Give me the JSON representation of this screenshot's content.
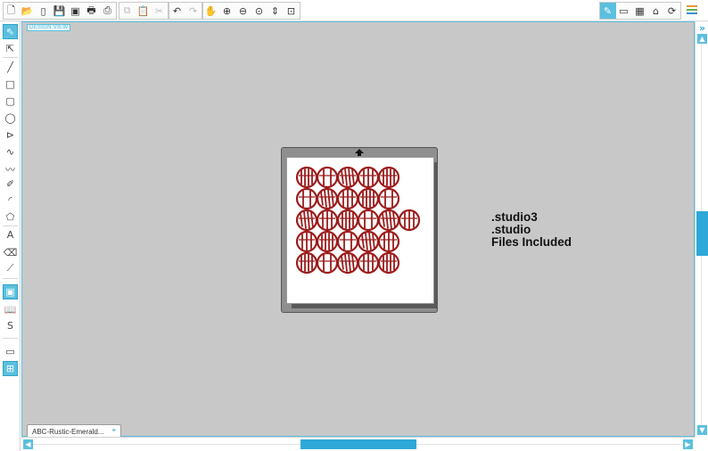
{
  "toolbar": {
    "left_tools": [
      {
        "name": "new-document-icon",
        "glyph": "🗋",
        "enabled": true
      },
      {
        "name": "open-folder-icon",
        "glyph": "📂",
        "enabled": true
      },
      {
        "name": "open-library-icon",
        "glyph": "▯",
        "enabled": true
      },
      {
        "name": "save-icon",
        "glyph": "💾",
        "enabled": true
      },
      {
        "name": "save-to-library-icon",
        "glyph": "▣",
        "enabled": true
      },
      {
        "name": "print-icon",
        "glyph": "🖶",
        "enabled": true
      },
      {
        "name": "send-to-cutter-icon",
        "glyph": "⎙",
        "enabled": true
      },
      {
        "name": "copy-icon",
        "glyph": "⧉",
        "enabled": false
      },
      {
        "name": "paste-icon",
        "glyph": "📋",
        "enabled": false
      },
      {
        "name": "cut-scissors-icon",
        "glyph": "✂",
        "enabled": false
      },
      {
        "name": "undo-icon",
        "glyph": "↶",
        "enabled": true
      },
      {
        "name": "redo-icon",
        "glyph": "↷",
        "enabled": false
      },
      {
        "name": "pan-hand-icon",
        "glyph": "✋",
        "enabled": true
      },
      {
        "name": "zoom-in-icon",
        "glyph": "⊕",
        "enabled": true
      },
      {
        "name": "zoom-out-icon",
        "glyph": "⊖",
        "enabled": true
      },
      {
        "name": "zoom-select-icon",
        "glyph": "⊙",
        "enabled": true
      },
      {
        "name": "zoom-drag-icon",
        "glyph": "⇕",
        "enabled": true
      },
      {
        "name": "fit-to-window-icon",
        "glyph": "⊡",
        "enabled": true
      }
    ],
    "right_tools": [
      {
        "name": "design-view-icon",
        "glyph": "✎",
        "active": true
      },
      {
        "name": "page-setup-icon",
        "glyph": "▭",
        "active": false
      },
      {
        "name": "cut-settings-icon",
        "glyph": "▦",
        "active": false
      },
      {
        "name": "library-home-icon",
        "glyph": "⌂",
        "active": false
      },
      {
        "name": "online-store-icon",
        "glyph": "⟳",
        "active": false
      }
    ],
    "menu_icon": "menu-lines-icon"
  },
  "left_panel": {
    "tools": [
      {
        "name": "select-arrow-icon",
        "glyph": "⇖",
        "active": true
      },
      {
        "name": "edit-points-icon",
        "glyph": "⇱",
        "active": false
      },
      {
        "name": "line-tool-icon",
        "glyph": "╱",
        "active": false
      },
      {
        "name": "rectangle-tool-icon",
        "glyph": "□",
        "active": false
      },
      {
        "name": "rounded-rectangle-tool-icon",
        "glyph": "▢",
        "active": false
      },
      {
        "name": "ellipse-tool-icon",
        "glyph": "◯",
        "active": false
      },
      {
        "name": "polygon-tool-icon",
        "glyph": "⊳",
        "active": false
      },
      {
        "name": "curve-tool-icon",
        "glyph": "∿",
        "active": false
      },
      {
        "name": "freehand-tool-icon",
        "glyph": "〰",
        "active": false
      },
      {
        "name": "smooth-freehand-tool-icon",
        "glyph": "✐",
        "active": false
      },
      {
        "name": "arc-tool-icon",
        "glyph": "◜",
        "active": false
      },
      {
        "name": "regular-polygon-tool-icon",
        "glyph": "⬠",
        "active": false
      },
      {
        "name": "text-tool-icon",
        "glyph": "A",
        "active": false
      },
      {
        "name": "eraser-tool-icon",
        "glyph": "⌫",
        "active": false
      },
      {
        "name": "knife-tool-icon",
        "glyph": "⟋",
        "active": false
      },
      {
        "name": "cut-mat-view-icon",
        "glyph": "▣",
        "active": true
      },
      {
        "name": "library-book-icon",
        "glyph": "📖",
        "active": false
      },
      {
        "name": "store-icon",
        "glyph": "S",
        "active": false
      },
      {
        "name": "single-pane-icon",
        "glyph": "▭",
        "active": false
      },
      {
        "name": "split-pane-icon",
        "glyph": "⊞",
        "active": true
      }
    ]
  },
  "canvas": {
    "design_view_label": "DESIGN VIEW",
    "background_color": "#c8c8c8",
    "info_text": {
      "line1": ".studio3",
      "line2": ".studio",
      "line3": "Files Included"
    },
    "design": {
      "color": "#9b1c1c",
      "rows": [
        5,
        5,
        6,
        5,
        5
      ]
    }
  },
  "document_tab": {
    "label": "ABC-Rustic-Emerald...",
    "pin_glyph": "⌖"
  },
  "scrollbars": {
    "accent_color": "#2ea8d8",
    "v_up": "▲",
    "v_down": "▼",
    "h_left": "◀",
    "h_right": "▶",
    "collapse_glyph": "»"
  }
}
